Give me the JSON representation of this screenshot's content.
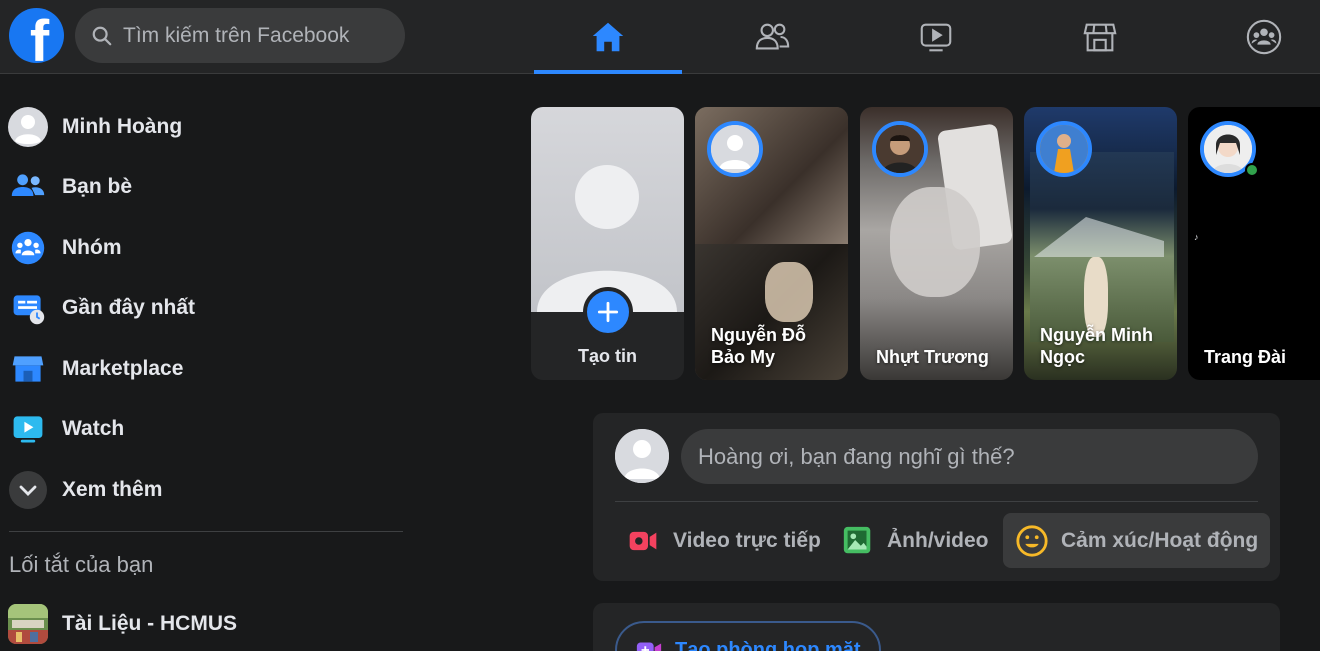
{
  "header": {
    "search_placeholder": "Tìm kiếm trên Facebook",
    "accent_color": "#2d88ff",
    "tabs": [
      {
        "name": "home",
        "icon": "home-icon",
        "active": true
      },
      {
        "name": "friends",
        "icon": "friends-icon",
        "active": false
      },
      {
        "name": "watch",
        "icon": "video-icon",
        "active": false
      },
      {
        "name": "marketplace",
        "icon": "store-icon",
        "active": false
      },
      {
        "name": "groups",
        "icon": "groups-icon",
        "active": false
      }
    ]
  },
  "sidebar": {
    "items": [
      {
        "label": "Minh Hoàng",
        "icon": "profile-avatar"
      },
      {
        "label": "Bạn bè",
        "icon": "friends-icon"
      },
      {
        "label": "Nhóm",
        "icon": "groups-icon"
      },
      {
        "label": "Gần đây nhất",
        "icon": "recent-icon"
      },
      {
        "label": "Marketplace",
        "icon": "marketplace-icon"
      },
      {
        "label": "Watch",
        "icon": "watch-icon"
      },
      {
        "label": "Xem thêm",
        "icon": "chevron-down-icon"
      }
    ],
    "shortcuts_heading": "Lối tắt của bạn",
    "shortcuts": [
      {
        "label": "Tài Liệu - HCMUS",
        "icon": "group-thumbnail"
      }
    ]
  },
  "stories": {
    "create_label": "Tạo tin",
    "items": [
      {
        "name": "Nguyễn Đỗ Bảo My"
      },
      {
        "name": "Nhựt Trương"
      },
      {
        "name": "Nguyễn Minh Ngọc"
      },
      {
        "name": "Trang Đài"
      }
    ]
  },
  "composer": {
    "placeholder": "Hoàng ơi, bạn đang nghĩ gì thế?",
    "actions": [
      {
        "label": "Video trực tiếp",
        "icon": "live-video-icon",
        "color": "#f3425f"
      },
      {
        "label": "Ảnh/video",
        "icon": "photo-icon",
        "color": "#45bd62"
      },
      {
        "label": "Cảm xúc/Hoạt động",
        "icon": "feeling-icon",
        "color": "#f7b928"
      }
    ]
  },
  "rooms": {
    "create_room_label": "Tạo phòng họp mặt"
  }
}
